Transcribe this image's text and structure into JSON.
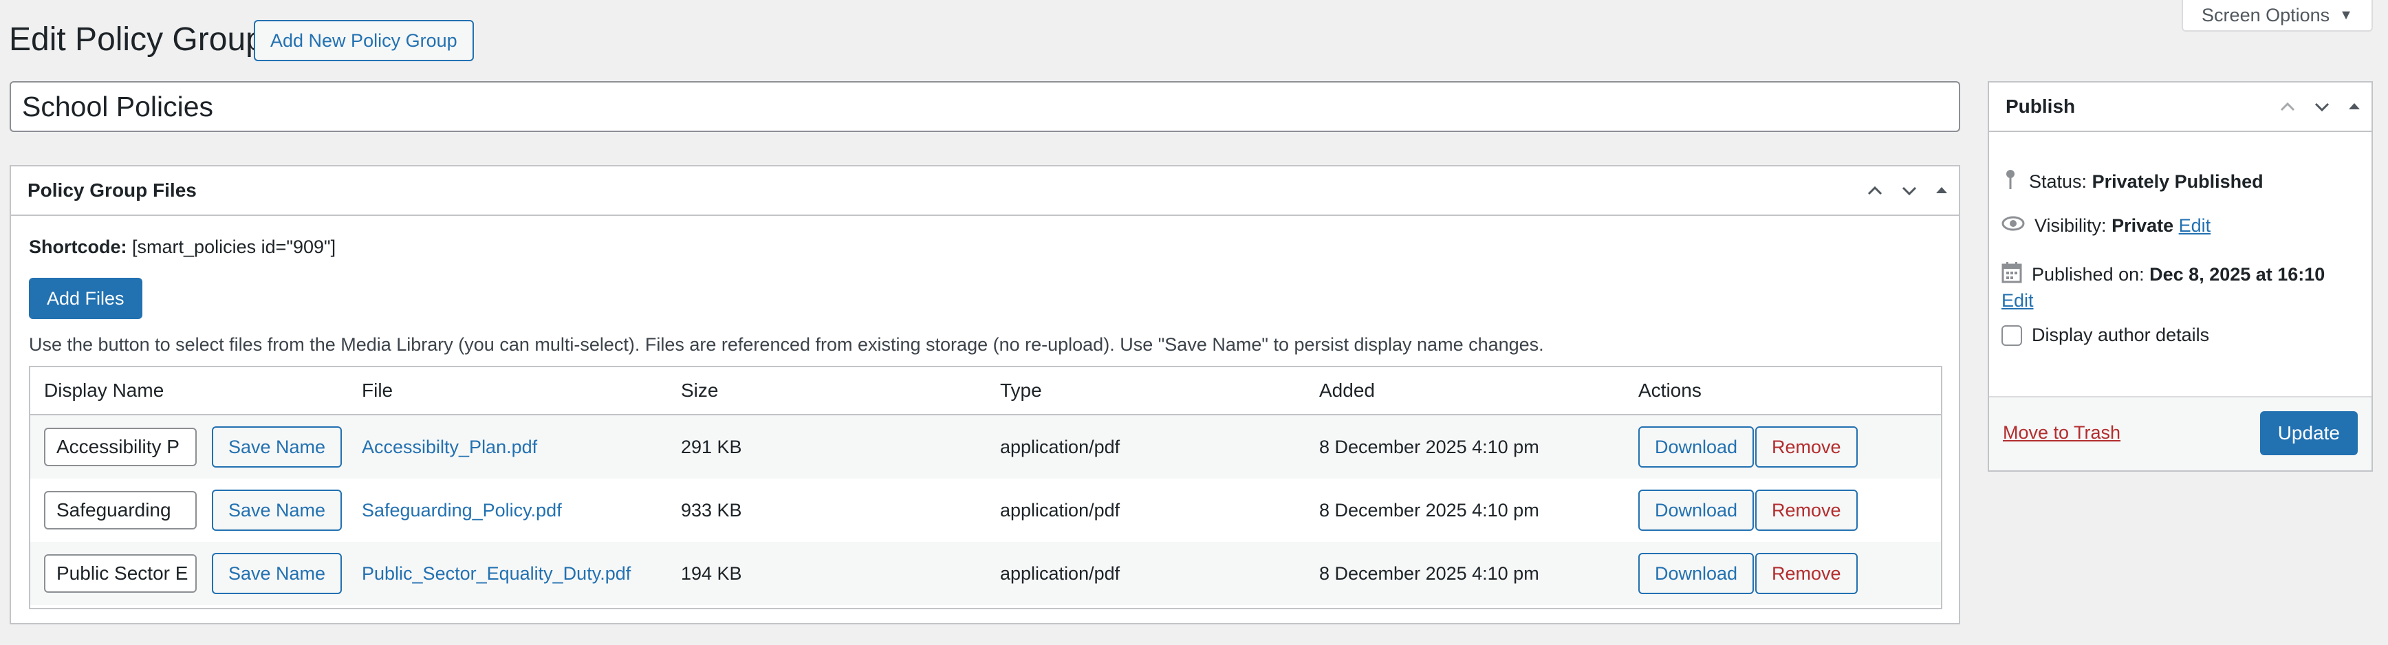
{
  "screen_options": {
    "label": "Screen Options"
  },
  "header": {
    "title": "Edit Policy Group",
    "add_new_label": "Add New Policy Group"
  },
  "post_title": {
    "value": "School Policies"
  },
  "files_box": {
    "title": "Policy Group Files",
    "shortcode_label": "Shortcode:",
    "shortcode_value": "[smart_policies id=\"909\"]",
    "add_files_label": "Add Files",
    "help_text": "Use the button to select files from the Media Library (you can multi-select). Files are referenced from existing storage (no re-upload). Use \"Save Name\" to persist display name changes.",
    "columns": [
      "Display Name",
      "File",
      "Size",
      "Type",
      "Added",
      "Actions"
    ],
    "save_name_label": "Save Name",
    "download_label": "Download",
    "remove_label": "Remove",
    "rows": [
      {
        "display_name": "Accessibility P",
        "file": "Accessibilty_Plan.pdf",
        "size": "291 KB",
        "type": "application/pdf",
        "added": "8 December 2025 4:10 pm"
      },
      {
        "display_name": "Safeguarding",
        "file": "Safeguarding_Policy.pdf",
        "size": "933 KB",
        "type": "application/pdf",
        "added": "8 December 2025 4:10 pm"
      },
      {
        "display_name": "Public Sector E",
        "file": "Public_Sector_Equality_Duty.pdf",
        "size": "194 KB",
        "type": "application/pdf",
        "added": "8 December 2025 4:10 pm"
      }
    ]
  },
  "publish": {
    "title": "Publish",
    "status_label": "Status:",
    "status_value": "Privately Published",
    "visibility_label": "Visibility:",
    "visibility_value": "Private",
    "visibility_edit": "Edit",
    "published_label": "Published on:",
    "published_value": "Dec 8, 2025 at 16:10",
    "published_edit": "Edit",
    "author_details_label": "Display author details",
    "trash_label": "Move to Trash",
    "update_label": "Update"
  },
  "colors": {
    "accent": "#2271b1",
    "danger": "#b32d2e",
    "background": "#f0f0f1"
  }
}
